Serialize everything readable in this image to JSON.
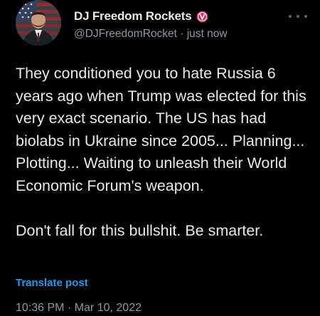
{
  "author": {
    "display_name": "DJ Freedom Rockets",
    "handle": "@DJFreedomRocket",
    "relative_time": "just now",
    "handle_line": "@DJFreedomRocket · just now",
    "badge_color": "#e0245e"
  },
  "post": {
    "paragraph_1": "They conditioned you to hate Russia 6 years ago when Trump was elected for this very exact scenario. The US has had biolabs in Ukraine since 2005... Planning... Plotting... Waiting to unleash their World Economic Forum's weapon.",
    "paragraph_2": "Don't fall for this bullshit. Be smarter."
  },
  "actions": {
    "translate_label": "Translate post",
    "more_icon": "more-horizontal-icon"
  },
  "meta": {
    "timestamp": "10:36 PM · Mar 10, 2022"
  },
  "colors": {
    "background": "#000000",
    "text": "#e7e9ea",
    "secondary": "#8b98a5",
    "link": "#1d9bf0"
  }
}
